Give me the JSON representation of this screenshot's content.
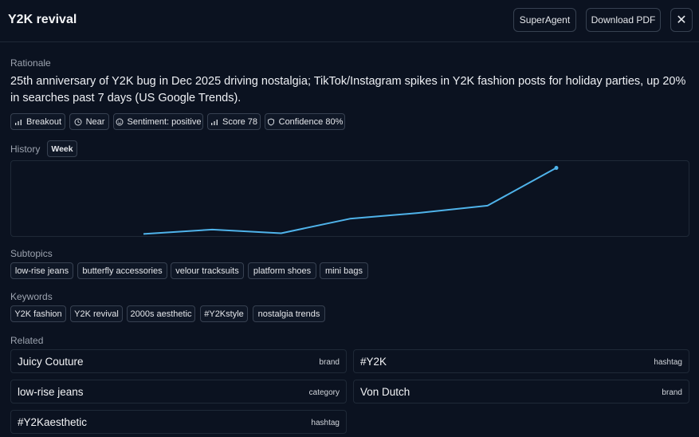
{
  "header": {
    "title": "Y2K revival",
    "superagent_label": "SuperAgent",
    "download_label": "Download PDF",
    "close_glyph": "✕"
  },
  "rationale": {
    "label": "Rationale",
    "text": "25th anniversary of Y2K bug in Dec 2025 driving nostalgia; TikTok/Instagram spikes in Y2K fashion posts for holiday parties, up 20% in searches past 7 days (US Google Trends)."
  },
  "badges": [
    {
      "icon": "bar-chart-icon",
      "label": "Breakout"
    },
    {
      "icon": "clock-icon",
      "label": "Near"
    },
    {
      "icon": "smile-icon",
      "label": "Sentiment: positive"
    },
    {
      "icon": "bar-chart-icon",
      "label": "Score 78"
    },
    {
      "icon": "shield-icon",
      "label": "Confidence 80%"
    }
  ],
  "history": {
    "label": "History",
    "period": "Week"
  },
  "chart_data": {
    "type": "line",
    "x": [
      0,
      1,
      2,
      3,
      4,
      5,
      6
    ],
    "values": [
      4,
      10,
      5,
      25,
      33,
      43,
      95
    ],
    "ylim": [
      0,
      100
    ],
    "grid": false,
    "line_color": "#4fb3ea"
  },
  "subtopics": {
    "label": "Subtopics",
    "items": [
      "low-rise jeans",
      "butterfly accessories",
      "velour tracksuits",
      "platform shoes",
      "mini bags"
    ]
  },
  "keywords": {
    "label": "Keywords",
    "items": [
      "Y2K fashion",
      "Y2K revival",
      "2000s aesthetic",
      "#Y2Kstyle",
      "nostalgia trends"
    ]
  },
  "related": {
    "label": "Related",
    "items": [
      {
        "name": "Juicy Couture",
        "type": "brand"
      },
      {
        "name": "#Y2K",
        "type": "hashtag"
      },
      {
        "name": "low-rise jeans",
        "type": "category"
      },
      {
        "name": "Von Dutch",
        "type": "brand"
      },
      {
        "name": "#Y2Kaesthetic",
        "type": "hashtag"
      }
    ]
  }
}
